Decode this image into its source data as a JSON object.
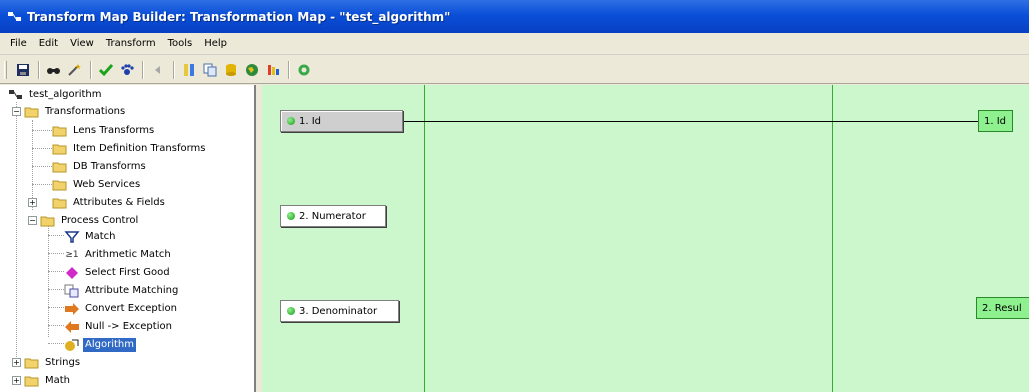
{
  "window": {
    "title": "Transform Map Builder:  Transformation Map - \"test_algorithm\""
  },
  "menu": {
    "items": [
      "File",
      "Edit",
      "View",
      "Transform",
      "Tools",
      "Help"
    ]
  },
  "toolbar": {
    "buttons": [
      "save-icon",
      "find-icon",
      "wand-icon",
      "check-icon",
      "paw-icon",
      "back-icon",
      "transform-icon",
      "copy-icon",
      "db-icon",
      "web-icon",
      "palette-icon",
      "refresh-icon"
    ]
  },
  "tree": {
    "root": "test_algorithm",
    "transformations": "Transformations",
    "lens": "Lens Transforms",
    "item_def": "Item Definition Transforms",
    "db": "DB Transforms",
    "web": "Web Services",
    "attributes": "Attributes & Fields",
    "process_control": "Process Control",
    "match": "Match",
    "arith_match": "Arithmetic Match",
    "arith_symbol": "≥1",
    "select_first": "Select First Good",
    "attr_matching": "Attribute Matching",
    "convert_exc": "Convert Exception",
    "null_exc": "Null -> Exception",
    "algorithm": "Algorithm",
    "strings": "Strings",
    "math": "Math"
  },
  "canvas": {
    "inputs": [
      "1. Id",
      "2. Numerator",
      "3. Denominator"
    ],
    "outputs": [
      "1. Id",
      "2. Resul"
    ]
  },
  "colors": {
    "canvas_bg": "#ccf7cc",
    "column_line": "#33aa33",
    "output_box": "#8ff08f",
    "title_bar": "#0a4fd8",
    "selection": "#316ac5"
  }
}
